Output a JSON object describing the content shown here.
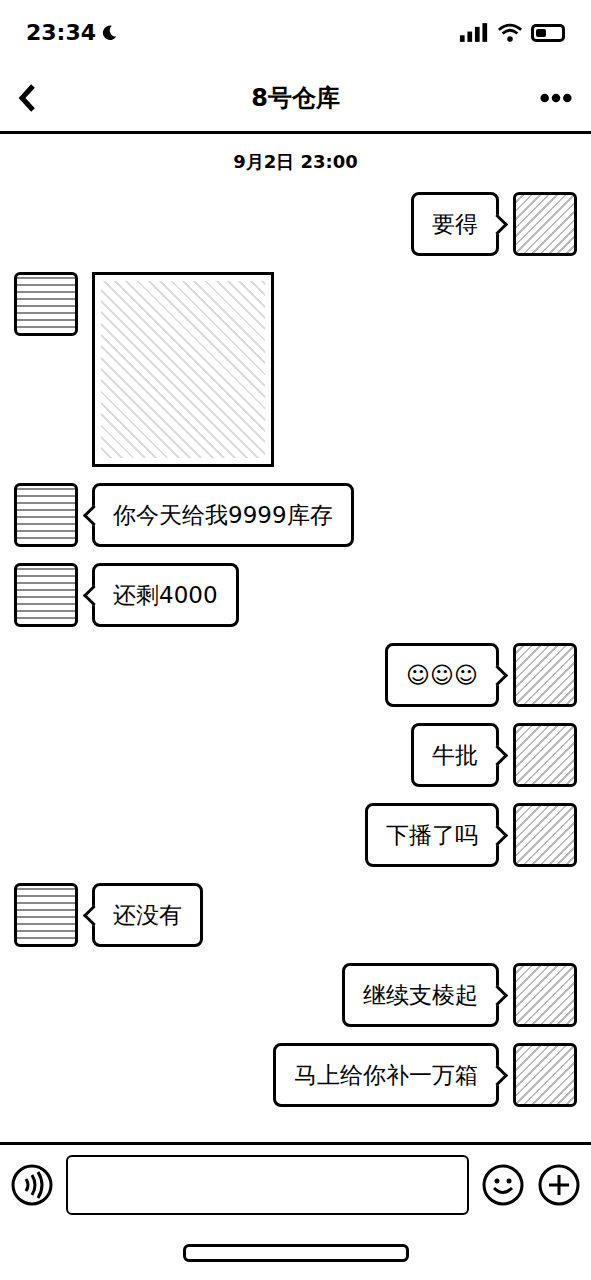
{
  "status_bar": {
    "time": "23:34",
    "battery": {
      "level": 0.4
    }
  },
  "header": {
    "title": "8号仓库"
  },
  "timestamp": "9月2日 23:00",
  "messages": [
    {
      "kind": "text",
      "outgoing": true,
      "text": "要得"
    },
    {
      "kind": "sticker",
      "outgoing": false
    },
    {
      "kind": "text",
      "outgoing": false,
      "text": "你今天给我9999库存"
    },
    {
      "kind": "text",
      "outgoing": false,
      "text": "还剩4000"
    },
    {
      "kind": "text",
      "outgoing": true,
      "text": "☺☺☺"
    },
    {
      "kind": "text",
      "outgoing": true,
      "text": "牛批"
    },
    {
      "kind": "text",
      "outgoing": true,
      "text": "下播了吗"
    },
    {
      "kind": "text",
      "outgoing": false,
      "text": "还没有"
    },
    {
      "kind": "text",
      "outgoing": true,
      "text": "继续支棱起"
    },
    {
      "kind": "text",
      "outgoing": true,
      "text": "马上给你补一万箱"
    }
  ]
}
